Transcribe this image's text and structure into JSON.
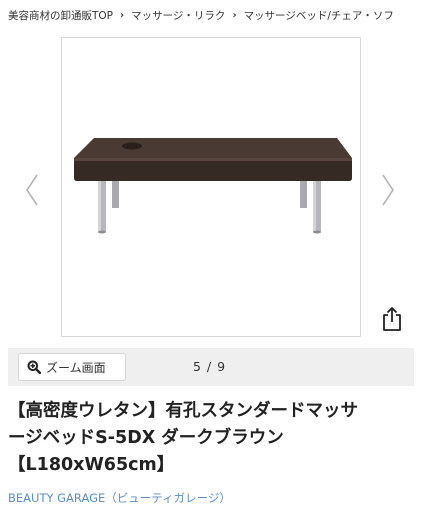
{
  "breadcrumb": {
    "items": [
      "美容商材の卸通販TOP",
      "マッサージ・リラク",
      "マッサージベッド/チェア・ソフ"
    ],
    "separator": "›"
  },
  "gallery": {
    "image_alt": "massage bed with face hole, dark brown",
    "prev_icon": "chevron-left-icon",
    "next_icon": "chevron-right-icon",
    "share_icon": "share-icon"
  },
  "zoom": {
    "button_label": "ズーム画面",
    "icon": "zoom-in-icon",
    "counter": "5 / 9"
  },
  "product": {
    "title_line1": "【高密度ウレタン】有孔スタンダードマッサ",
    "title_line2": "ージベッドS-5DX ダークブラウン",
    "title_line3": "【L180xW65cm】",
    "brand": "BEAUTY GARAGE（ビューティガレージ）"
  },
  "colors": {
    "bed_top": "#3f302b",
    "legs": "#b7b7bd",
    "brand_link": "#5a8ec4",
    "zoombar_bg": "#efefef"
  }
}
